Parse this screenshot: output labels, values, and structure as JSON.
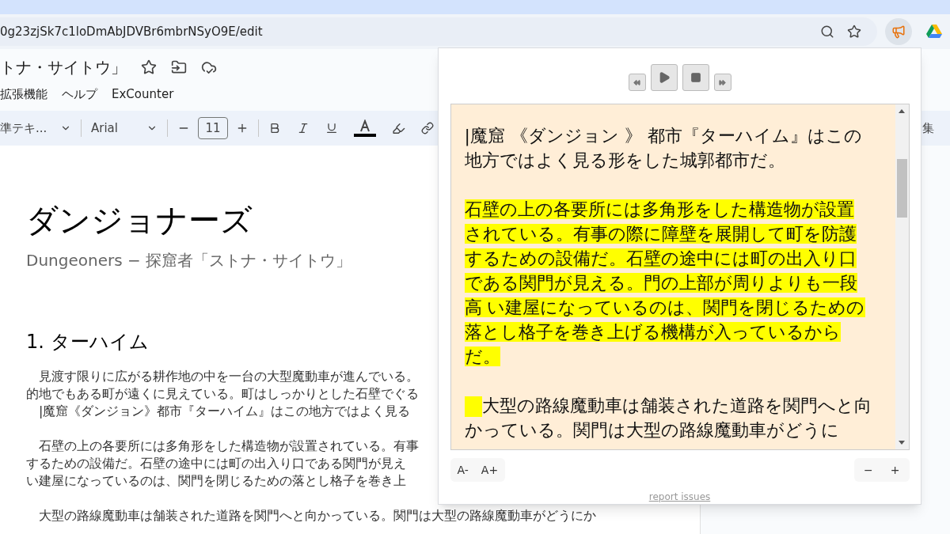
{
  "browser": {
    "url": "0g23zjSk7c1loDmAbJDVBr6mbrNSyO9E/edit"
  },
  "docs": {
    "title": "トナ・サイトウ」",
    "menu": [
      "拡張機能",
      "ヘルプ",
      "ExCounter"
    ],
    "toolbar": {
      "style": "準テキ...",
      "font": "Arial",
      "font_size": "11",
      "right_label": "集"
    },
    "heading": "ダンジョナーズ",
    "subtitle": "Dungeoners − 探窟者「ストナ・サイトウ」",
    "section": "1.  ターハイム",
    "paragraphs": [
      [
        "見渡す限りに広がる耕作地の中を一台の大型魔動車が進んでいる。",
        "的地でもある町が遠くに見えている。町はしっかりとした石壁でぐる",
        "|魔窟《ダンジョン》都市『ターハイム』はこの地方ではよく見る"
      ],
      [
        "石壁の上の各要所には多角形をした構造物が設置されている。有事",
        "するための設備だ。石壁の途中には町の出入り口である関門が見え",
        "い建屋になっているのは、関門を閉じるための落とし格子を巻き上"
      ],
      [
        "大型の路線魔動車は舗装された道路を関門へと向かっている。関門は大型の路線魔動車がどうにか"
      ]
    ]
  },
  "reader": {
    "paragraphs": [
      {
        "text": "|魔窟 《ダンジョン 》 都市『ターハイム』はこの地方ではよく見る形をした城郭都市だ。",
        "highlighted": false,
        "lead_marker": false
      },
      {
        "text": "石壁の上の各要所には多角形をした構造物が設置されている。有事の際に障壁を展開して町を防護するための設備だ。石壁の途中には町の出入り口である関門が見える。門の上部が周りよりも一段高 い建屋になっているのは、関門を閉じるための落とし格子を巻き上げる機構が入っているからだ。",
        "highlighted": true,
        "lead_marker": false
      },
      {
        "text": "大型の路線魔動車は舗装された道路を関門へと向かっている。関門は大型の路線魔動車がどうに",
        "highlighted": false,
        "lead_marker": true
      }
    ],
    "font_buttons": [
      "A-",
      "A+"
    ],
    "zoom_buttons": [
      "−",
      "+"
    ],
    "link": "report issues"
  }
}
